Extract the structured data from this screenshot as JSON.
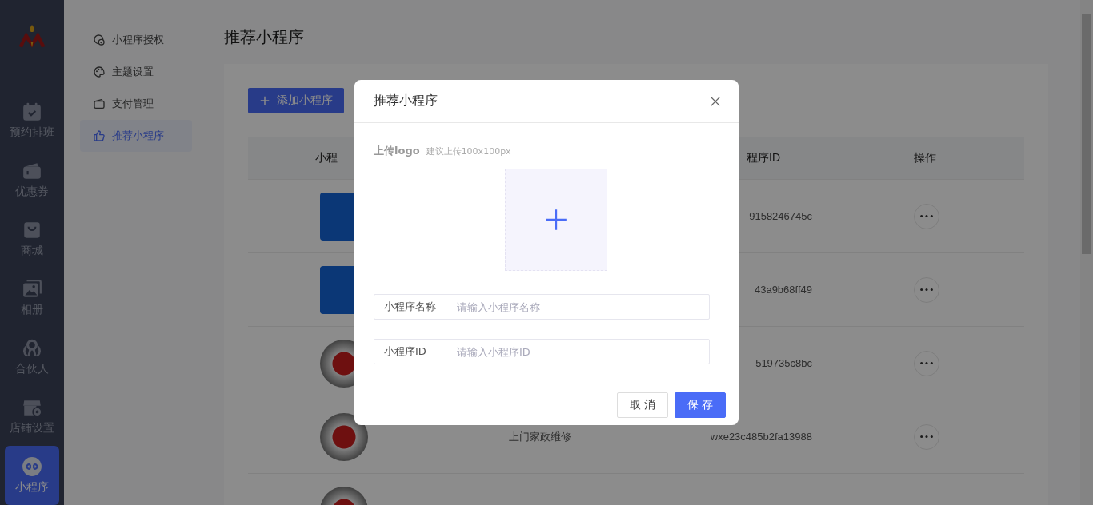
{
  "nav": {
    "items": [
      {
        "label": "预约排班",
        "selected": false
      },
      {
        "label": "优惠券",
        "selected": false
      },
      {
        "label": "商城",
        "selected": false
      },
      {
        "label": "相册",
        "selected": false
      },
      {
        "label": "合伙人",
        "selected": false
      },
      {
        "label": "店铺设置",
        "selected": false
      },
      {
        "label": "小程序",
        "selected": true
      }
    ]
  },
  "submenu": {
    "items": [
      {
        "label": "小程序授权",
        "selected": false
      },
      {
        "label": "主题设置",
        "selected": false
      },
      {
        "label": "支付管理",
        "selected": false
      },
      {
        "label": "推荐小程序",
        "selected": true
      }
    ]
  },
  "page": {
    "title": "推荐小程序"
  },
  "add_button": {
    "label": "添加小程序"
  },
  "table": {
    "header": {
      "logo": "小程",
      "id": "程序ID",
      "actions": "操作"
    },
    "rows": [
      {
        "kind": "tile",
        "id": "9158246745c",
        "menu": true
      },
      {
        "kind": "tile",
        "id": "43a9b68ff49",
        "menu": true
      },
      {
        "kind": "qrcode",
        "id": "519735c8bc",
        "menu": true
      },
      {
        "kind": "qrcode",
        "name": "上门家政维修",
        "id": "wxe23c485b2fa13988",
        "menu": true
      },
      {
        "kind": "qrcode",
        "menu": false
      }
    ]
  },
  "modal": {
    "title": "推荐小程序",
    "upload": {
      "label": "上传logo",
      "hint": "建议上传100x100px"
    },
    "fields": [
      {
        "label": "小程序名称",
        "placeholder": "请输入小程序名称"
      },
      {
        "label": "小程序ID",
        "placeholder": "请输入小程序ID"
      }
    ],
    "buttons": [
      {
        "label": "取 消",
        "kind": "default"
      },
      {
        "label": "保 存",
        "kind": "primary"
      }
    ]
  }
}
